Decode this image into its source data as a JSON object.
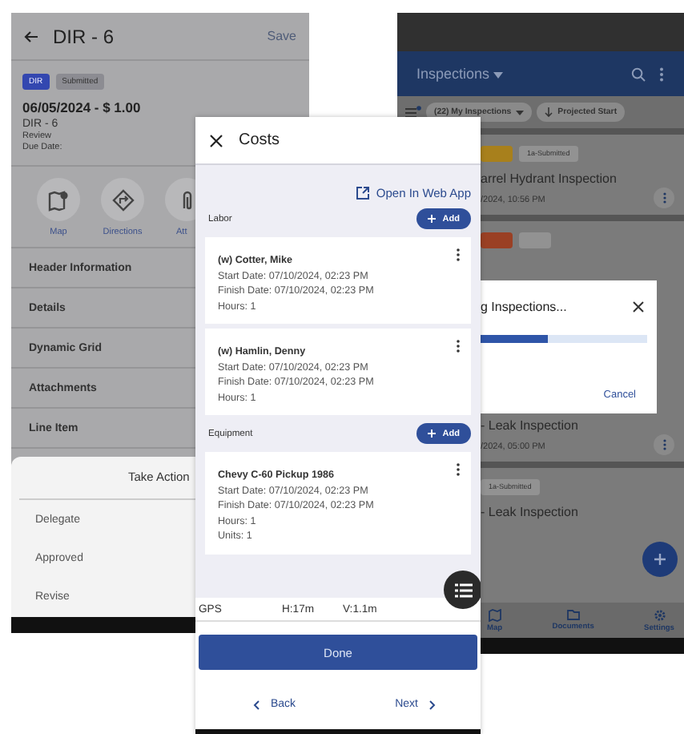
{
  "detail_screen": {
    "title": "DIR - 6",
    "save_label": "Save",
    "tags": [
      {
        "label": "DIR",
        "color": "#3347b0"
      },
      {
        "label": "Submitted",
        "color": "#8c8c92"
      }
    ],
    "headline": "06/05/2024 - $ 1.00",
    "record": "DIR - 6",
    "status": "Review",
    "due_date": "Due Date:",
    "actions": [
      {
        "label": "Map",
        "kind": "map"
      },
      {
        "label": "Directions",
        "kind": "directions"
      },
      {
        "label": "Att",
        "kind": "attach"
      }
    ],
    "sections": [
      "Header Information",
      "Details",
      "Dynamic Grid",
      "Attachments",
      "Line Item"
    ],
    "action_sheet": {
      "title": "Take Action",
      "options": [
        "Delegate",
        "Approved",
        "Revise"
      ]
    }
  },
  "costs_screen": {
    "title": "Costs",
    "web_link": "Open In Web App",
    "groups": [
      {
        "title": "Labor",
        "add_label": "Add",
        "entries": [
          {
            "name": "(w) Cotter, Mike",
            "lines": [
              "Start Date: 07/10/2024, 02:23 PM",
              "Finish Date: 07/10/2024, 02:23 PM",
              "Hours: 1"
            ]
          },
          {
            "name": "(w) Hamlin, Denny",
            "lines": [
              "Start Date: 07/10/2024, 02:23 PM",
              "Finish Date: 07/10/2024, 02:23 PM",
              "Hours: 1"
            ]
          }
        ]
      },
      {
        "title": "Equipment",
        "add_label": "Add",
        "entries": [
          {
            "name": "Chevy C-60 Pickup 1986",
            "lines": [
              "Start Date: 07/10/2024, 02:23 PM",
              "Finish Date: 07/10/2024, 02:23 PM",
              "Hours: 1",
              "Units: 1"
            ]
          }
        ]
      }
    ],
    "gps": {
      "label": "GPS",
      "horizontal": "H:17m",
      "vertical": "V:1.1m"
    },
    "done_label": "Done",
    "back_label": "Back",
    "next_label": "Next"
  },
  "inspections_screen": {
    "title": "Inspections",
    "filters": [
      {
        "label": "(22) My Inspections",
        "kind": "dropdown"
      },
      {
        "label": "Projected Start",
        "kind": "sort"
      }
    ],
    "cards": [
      {
        "tags": [
          {
            "color": "#a8801c"
          },
          {
            "label": "1a-Submitted",
            "color": "#929292"
          }
        ],
        "title": "arrel Hydrant Inspection",
        "date": "/2024, 10:56 PM"
      },
      {
        "tags": [
          {
            "color": "#9a4024"
          },
          {
            "color": "#929292"
          }
        ],
        "title": "- Leak Inspection",
        "date": "/2024, 05:00 PM"
      },
      {
        "tags": [
          {
            "label": "1a-Submitted",
            "color": "#929292"
          }
        ],
        "title": "- Leak Inspection"
      }
    ],
    "dialog": {
      "title": "g Inspections...",
      "level": 0.4,
      "cancel_label": "Cancel"
    },
    "nav": [
      {
        "label": "Map",
        "kind": "map"
      },
      {
        "label": "Documents",
        "kind": "folder"
      },
      {
        "label": "Settings",
        "kind": "gear"
      }
    ]
  }
}
